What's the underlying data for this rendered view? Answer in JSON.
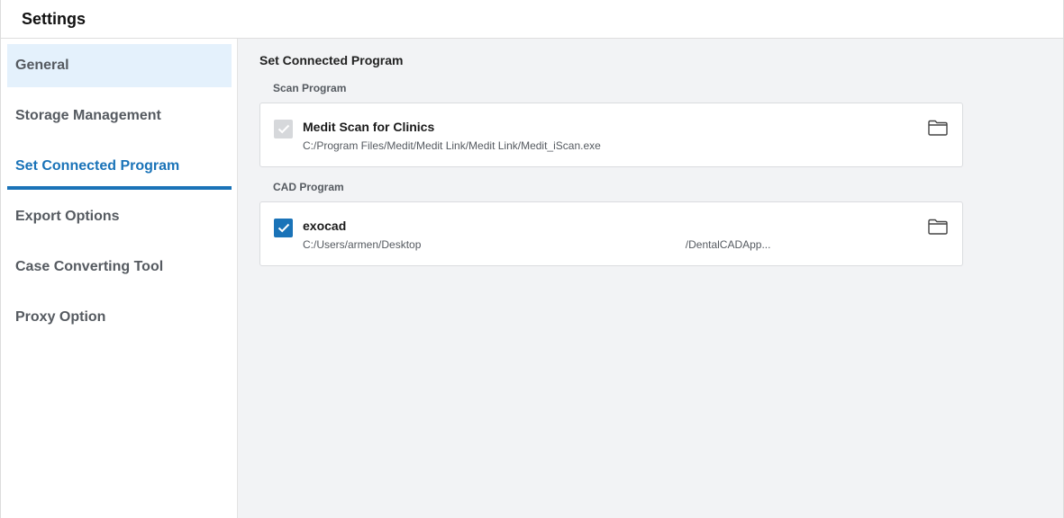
{
  "window": {
    "title": "Settings"
  },
  "sidebar": {
    "items": [
      {
        "label": "General"
      },
      {
        "label": "Storage Management"
      },
      {
        "label": "Set Connected Program"
      },
      {
        "label": "Export Options"
      },
      {
        "label": "Case Converting Tool"
      },
      {
        "label": "Proxy Option"
      }
    ]
  },
  "main": {
    "section_title": "Set Connected Program",
    "scan_program": {
      "group_label": "Scan Program",
      "name": "Medit Scan for Clinics",
      "path": "C:/Program Files/Medit/Medit Link/Medit Link/Medit_iScan.exe",
      "checked": true,
      "enabled": false,
      "icon": "folder-icon"
    },
    "cad_program": {
      "group_label": "CAD Program",
      "name": "exocad",
      "path": "C:/Users/armen/Desktop                                                                                        /DentalCADApp...",
      "checked": true,
      "enabled": true,
      "icon": "folder-icon"
    }
  },
  "colors": {
    "accent": "#1a73b8",
    "selected_bg": "#e4f1fc",
    "content_bg": "#f2f3f5",
    "disabled_check": "#d6d8db"
  }
}
